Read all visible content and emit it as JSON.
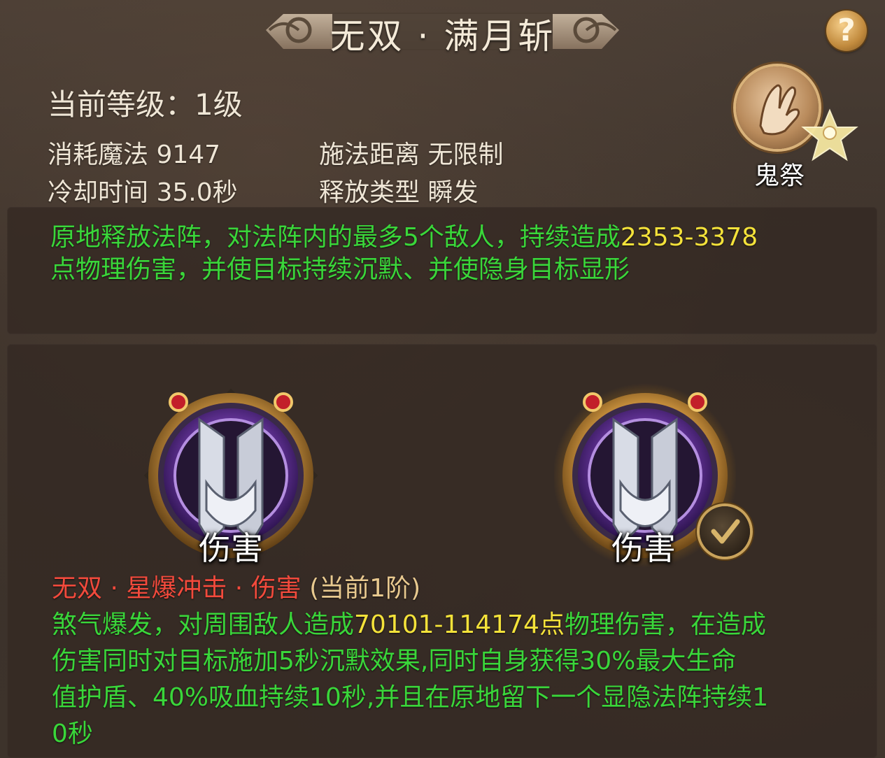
{
  "title": "无双 · 满月斩",
  "help_label": "?",
  "stats": {
    "level_label": "当前等级：",
    "level_value": "1级",
    "mana_label": "消耗魔法",
    "mana_value": "9147",
    "cooldown_label": "冷却时间",
    "cooldown_value": "35.0秒",
    "range_label": "施法距离",
    "range_value": "无限制",
    "cast_label": "释放类型",
    "cast_value": "瞬发"
  },
  "skill_badge": {
    "name": "鬼祭",
    "icon": "hand-gesture-icon"
  },
  "description": {
    "line1_green": "原地释放法阵，对法阵内的最多5个敌人，持续造成",
    "line1_yellow": "2353-3378",
    "line2_green": "点物理伤害，并使目标持续沉默、并使隐身目标显形"
  },
  "runes": [
    {
      "label": "伤害",
      "selected": false,
      "icon": "rune-damage-icon"
    },
    {
      "label": "伤害",
      "selected": true,
      "icon": "rune-damage-icon"
    }
  ],
  "rune_detail": {
    "title_red": "无双 · 星爆冲击 · 伤害",
    "title_tan": "(当前1阶)",
    "l1_green_a": "煞气爆发，对周围敌人造成",
    "l1_yellow": "70101-114174点",
    "l1_green_b": "物理伤害，在造成",
    "l2": "伤害同时对目标施加5秒沉默效果,同时自身获得30%最大生命",
    "l3": "值护盾、40%吸血持续10秒,并且在原地留下一个显隐法阵持续1",
    "l4": "0秒"
  },
  "colors": {
    "green": "#3ad63a",
    "yellow": "#f4e23a",
    "red": "#f24a3c",
    "gold": "#c9a35c",
    "purple": "#6b3fa0"
  }
}
